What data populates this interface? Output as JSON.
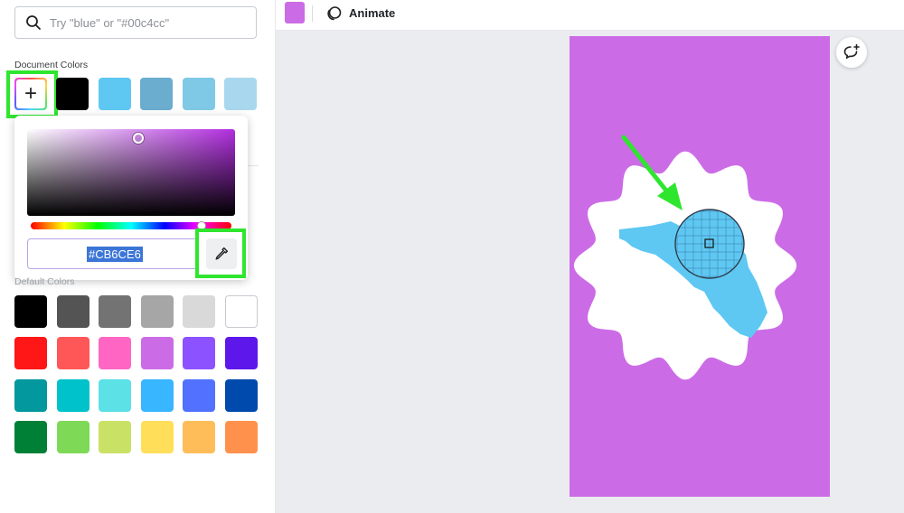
{
  "search": {
    "placeholder": "Try \"blue\" or \"#00c4cc\""
  },
  "document_colors": {
    "label": "Document Colors",
    "swatches": [
      "#000000",
      "#5ec8f2",
      "#6aadcf",
      "#7fc9e6",
      "#a9d8ee"
    ]
  },
  "default_colors": {
    "label": "Default Colors",
    "rows": [
      [
        "#000000",
        "#545454",
        "#737373",
        "#a6a6a6",
        "#d9d9d9",
        "#ffffff"
      ],
      [
        "#ff1616",
        "#ff5757",
        "#ff66c4",
        "#cb6ce6",
        "#8c52ff",
        "#5e17eb"
      ],
      [
        "#03989e",
        "#00c2cb",
        "#5ce1e6",
        "#38b6ff",
        "#5271ff",
        "#004aad"
      ],
      [
        "#008037",
        "#7ed957",
        "#c9e265",
        "#ffde59",
        "#ffbd59",
        "#ff914d"
      ]
    ]
  },
  "picker": {
    "hex": "#CB6CE6",
    "hue_fraction": 0.85
  },
  "toolbar": {
    "color": "#cb6ce6",
    "animate_label": "Animate"
  },
  "page": {
    "background": "#cb6ce6",
    "badge_color": "#ffffff",
    "map_color": "#5ec8f2"
  },
  "highlight_color": "#2ee62e"
}
